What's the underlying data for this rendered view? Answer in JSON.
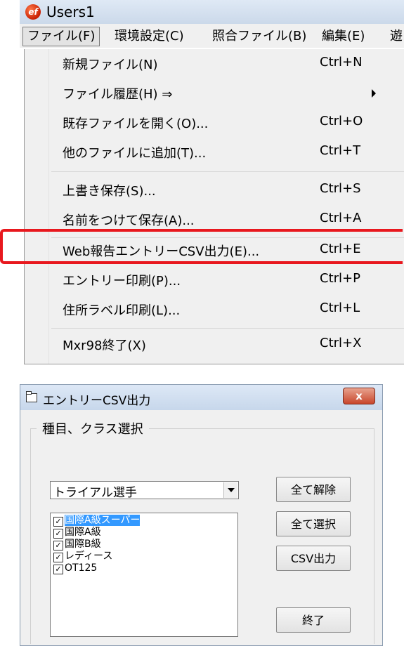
{
  "app_window": {
    "title": "Users1",
    "logo_text": "ef"
  },
  "menubar": {
    "file": "ファイル(F)",
    "environment": "環境設定(C)",
    "match_file": "照合ファイル(B)",
    "edit": "編集(E)",
    "more": "遊"
  },
  "file_menu": {
    "items": [
      {
        "label": "新規ファイル(N)",
        "shortcut": "Ctrl+N"
      },
      {
        "label": "ファイル履歴(H) ⇒",
        "shortcut": ""
      },
      {
        "label": "既存ファイルを開く(O)...",
        "shortcut": "Ctrl+O"
      },
      {
        "label": "他のファイルに追加(T)...",
        "shortcut": "Ctrl+T"
      },
      {
        "label": "上書き保存(S)...",
        "shortcut": "Ctrl+S"
      },
      {
        "label": "名前をつけて保存(A)...",
        "shortcut": "Ctrl+A"
      },
      {
        "label": "Web報告エントリーCSV出力(E)...",
        "shortcut": "Ctrl+E"
      },
      {
        "label": "エントリー印刷(P)...",
        "shortcut": "Ctrl+P"
      },
      {
        "label": "住所ラベル印刷(L)...",
        "shortcut": "Ctrl+L"
      },
      {
        "label": "Mxr98終了(X)",
        "shortcut": "Ctrl+X"
      }
    ],
    "highlight_color": "#e8181e"
  },
  "dialog": {
    "title": "エントリーCSV出力",
    "close_label": "x",
    "group_label": "種目、クラス選択",
    "combo_value": "トライアル選手",
    "list_items": [
      {
        "label": "国際A級スーパー",
        "checked": true,
        "selected": true
      },
      {
        "label": "国際A級",
        "checked": true,
        "selected": false
      },
      {
        "label": "国際B級",
        "checked": true,
        "selected": false
      },
      {
        "label": "レディース",
        "checked": true,
        "selected": false
      },
      {
        "label": "OT125",
        "checked": true,
        "selected": false
      }
    ],
    "buttons": {
      "clear_all": "全て解除",
      "select_all": "全て選択",
      "csv_output": "CSV出力",
      "exit": "終了"
    },
    "check_mark": "✓"
  }
}
